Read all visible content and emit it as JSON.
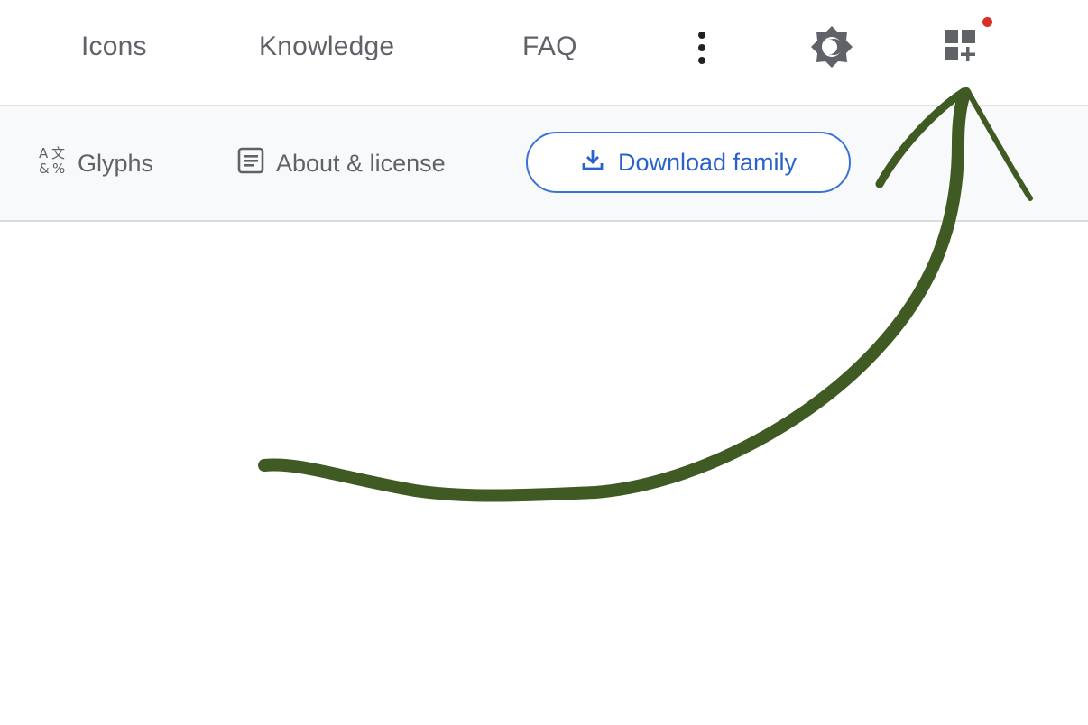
{
  "nav": {
    "links": [
      {
        "label": "Icons"
      },
      {
        "label": "Knowledge"
      },
      {
        "label": "FAQ"
      }
    ],
    "more_icon": "more-vert-icon",
    "theme_icon": "brightness-icon",
    "apps_icon": "widget-add-icon",
    "notification_color": "#d93025"
  },
  "subnav": {
    "glyphs_label": "Glyphs",
    "glyphs_icon": "glyphs-icon",
    "about_label": "About & license",
    "about_icon": "article-icon",
    "download_label": "Download family",
    "download_icon": "download-icon"
  },
  "colors": {
    "accent": "#2962c9",
    "text_muted": "#5f6368",
    "annotation_arrow": "#3f5a23"
  }
}
